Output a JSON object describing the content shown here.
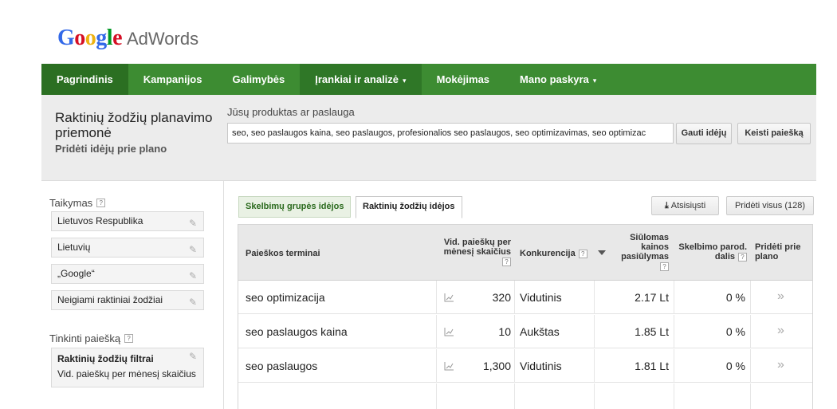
{
  "logo": {
    "google": "Google",
    "product": "AdWords"
  },
  "nav": {
    "items": [
      {
        "label": "Pagrindinis",
        "caret": ""
      },
      {
        "label": "Kampanijos",
        "caret": ""
      },
      {
        "label": "Galimybės",
        "caret": ""
      },
      {
        "label": "Įrankiai ir analizė",
        "caret": "▾"
      },
      {
        "label": "Mokėjimas",
        "caret": ""
      },
      {
        "label": "Mano paskyra",
        "caret": "▾"
      }
    ]
  },
  "header": {
    "title": "Raktinių žodžių planavimo priemonė",
    "add_ideas": "Pridėti idėjų prie plano",
    "product_label": "Jūsų produktas ar paslauga",
    "search_value": "seo, seo paslaugos kaina, seo paslaugos, profesionalios seo paslaugos, seo optimizavimas, seo optimizac",
    "get_ideas": "Gauti idėjų",
    "change_search": "Keisti paiešką"
  },
  "left": {
    "targeting_title": "Taikymas",
    "targeting_items": [
      "Lietuvos Respublika",
      "Lietuvių",
      "„Google“",
      "Neigiami raktiniai žodžiai"
    ],
    "customize_title": "Tinkinti paiešką",
    "filter_title": "Raktinių žodžių filtrai",
    "filter_sub": "Vid. paieškų per mėnesį skaičius",
    "help": "?",
    "pencil": "✎"
  },
  "tabs": [
    "Skelbimų grupės idėjos",
    "Raktinių žodžių idėjos"
  ],
  "actions": {
    "download": "Atsisiųsti",
    "download_icon": "⤓",
    "add_all": "Pridėti visus (128)"
  },
  "table": {
    "headers": {
      "term": "Paieškos terminai",
      "searches_1": "Vid. paieškų per",
      "searches_2": "mėnesį skaičius",
      "competition": "Konkurencija",
      "bid_1": "Siūlomas",
      "bid_2": "kainos",
      "bid_3": "pasiūlymas",
      "share_1": "Skelbimo parod.",
      "share_2": "dalis",
      "add_1": "Pridėti prie",
      "add_2": "plano"
    },
    "rows": [
      {
        "term": "seo optimizacija",
        "searches": "320",
        "competition": "Vidutinis",
        "bid": "2.17 Lt",
        "share": "0 %",
        "add": "»"
      },
      {
        "term": "seo paslaugos kaina",
        "searches": "10",
        "competition": "Aukštas",
        "bid": "1.85 Lt",
        "share": "0 %",
        "add": "»"
      },
      {
        "term": "seo paslaugos",
        "searches": "1,300",
        "competition": "Vidutinis",
        "bid": "1.81 Lt",
        "share": "0 %",
        "add": "»"
      }
    ]
  },
  "colors": {
    "nav_green": "#3d8c32",
    "nav_active": "#2b6f22",
    "header_gray": "#ececec"
  }
}
